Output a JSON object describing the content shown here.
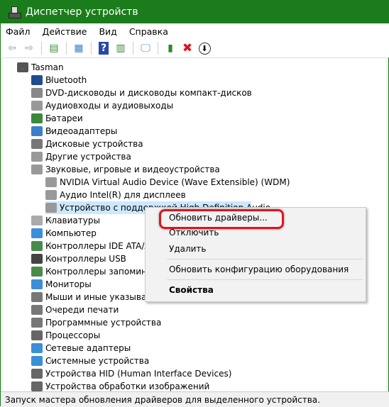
{
  "window": {
    "title": "Диспетчер устройств",
    "accent": "#1a7c1a"
  },
  "menu": [
    "Файл",
    "Действие",
    "Вид",
    "Справка"
  ],
  "toolbar": [
    "back-icon",
    "forward-icon",
    "show-hide-console-tree-icon",
    "properties-icon",
    "help-icon",
    "action-pane-icon",
    "scan-hardware-icon",
    "update-driver-icon",
    "uninstall-icon",
    "disable-icon"
  ],
  "tree": [
    {
      "label": "Tasman",
      "level": 0,
      "exp": "open",
      "icon": "computer",
      "color": "#555"
    },
    {
      "label": "Bluetooth",
      "level": 1,
      "exp": "closed",
      "icon": "bluetooth",
      "color": "#1d4f8f"
    },
    {
      "label": "DVD-дисководы и дисководы компакт-дисков",
      "level": 1,
      "exp": "closed",
      "icon": "dvd",
      "color": "#888"
    },
    {
      "label": "Аудиовходы и аудиовыходы",
      "level": 1,
      "exp": "closed",
      "icon": "speaker",
      "color": "#999"
    },
    {
      "label": "Батареи",
      "level": 1,
      "exp": "closed",
      "icon": "battery",
      "color": "#3a8a3a"
    },
    {
      "label": "Видеоадаптеры",
      "level": 1,
      "exp": "closed",
      "icon": "display-adapter",
      "color": "#3b7ec9"
    },
    {
      "label": "Дисковые устройства",
      "level": 1,
      "exp": "closed",
      "icon": "disk",
      "color": "#777"
    },
    {
      "label": "Другие устройства",
      "level": 1,
      "exp": "closed",
      "icon": "unknown-device",
      "color": "#999"
    },
    {
      "label": "Звуковые, игровые и видеоустройства",
      "level": 1,
      "exp": "open",
      "icon": "speaker",
      "color": "#999"
    },
    {
      "label": "NVIDIA Virtual Audio Device (Wave Extensible) (WDM)",
      "level": 2,
      "exp": "none",
      "icon": "speaker",
      "color": "#999"
    },
    {
      "label": "Аудио Intel(R) для дисплеев",
      "level": 2,
      "exp": "none",
      "icon": "speaker",
      "color": "#999"
    },
    {
      "label": "Устройство с поддержкой High Definition Audio",
      "level": 2,
      "exp": "none",
      "icon": "speaker",
      "color": "#999",
      "selected": true
    },
    {
      "label": "Клавиатуры",
      "level": 1,
      "exp": "closed",
      "icon": "keyboard",
      "color": "#aaa"
    },
    {
      "label": "Компьютер",
      "level": 1,
      "exp": "closed",
      "icon": "monitor",
      "color": "#3b8fd9"
    },
    {
      "label": "Контроллеры IDE ATA/ATAPI",
      "level": 1,
      "exp": "closed",
      "icon": "ide",
      "color": "#4a8a4a"
    },
    {
      "label": "Контроллеры USB",
      "level": 1,
      "exp": "closed",
      "icon": "usb",
      "color": "#444"
    },
    {
      "label": "Контроллеры запоминающих устройств",
      "level": 1,
      "exp": "closed",
      "icon": "storage",
      "color": "#4a8a4a"
    },
    {
      "label": "Мониторы",
      "level": 1,
      "exp": "closed",
      "icon": "monitor",
      "color": "#3b8fd9"
    },
    {
      "label": "Мыши и иные указывающие устройства",
      "level": 1,
      "exp": "closed",
      "icon": "mouse",
      "color": "#777"
    },
    {
      "label": "Очереди печати",
      "level": 1,
      "exp": "closed",
      "icon": "printer",
      "color": "#777"
    },
    {
      "label": "Программные устройства",
      "level": 1,
      "exp": "closed",
      "icon": "software",
      "color": "#777"
    },
    {
      "label": "Процессоры",
      "level": 1,
      "exp": "closed",
      "icon": "cpu",
      "color": "#666"
    },
    {
      "label": "Сетевые адаптеры",
      "level": 1,
      "exp": "closed",
      "icon": "network",
      "color": "#3b8fd9"
    },
    {
      "label": "Системные устройства",
      "level": 1,
      "exp": "closed",
      "icon": "system",
      "color": "#3b8fd9"
    },
    {
      "label": "Устройства HID (Human Interface Devices)",
      "level": 1,
      "exp": "closed",
      "icon": "hid",
      "color": "#666"
    },
    {
      "label": "Устройства обработки изображений",
      "level": 1,
      "exp": "open",
      "icon": "camera",
      "color": "#666"
    }
  ],
  "context_menu": {
    "items": [
      "Обновить драйверы...",
      "Отключить",
      "Удалить",
      "Обновить конфигурацию оборудования",
      "Свойства"
    ],
    "highlight_color": "#e0141e"
  },
  "status": "Запуск мастера обновления драйверов для выделенного устройства."
}
